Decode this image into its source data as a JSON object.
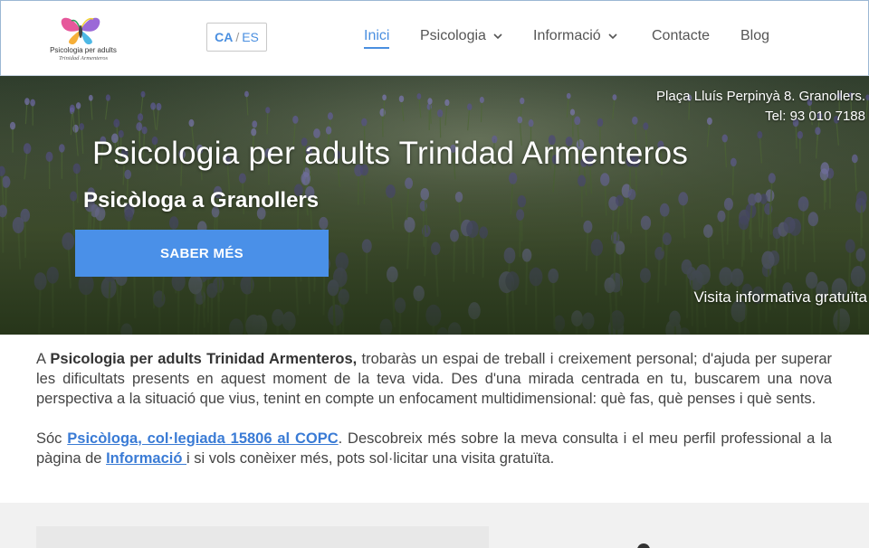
{
  "header": {
    "logo": {
      "line1": "Psicologia per adults",
      "line2": "Trinidad Armenteros"
    },
    "lang": {
      "active": "CA",
      "separator": "/",
      "other": "ES"
    },
    "nav": [
      {
        "label": "Inici",
        "current": true
      },
      {
        "label": "Psicologia",
        "dropdown": true
      },
      {
        "label": "Informació",
        "dropdown": true
      },
      {
        "label": "Contacte"
      },
      {
        "label": "Blog"
      }
    ]
  },
  "hero": {
    "address_line1": "Plaça Lluís Perpinyà 8. Granollers.",
    "address_line2": "Tel: 93 010 7188",
    "title": "Psicologia per adults Trinidad Armenteros",
    "subtitle": "Psicòloga a Granollers",
    "cta_label": "SABER MÉS",
    "visit_text": "Visita informativa gratuïta"
  },
  "content": {
    "p1_bold": "Psicologia per adults Trinidad Armenteros,",
    "p1_prefix": "A ",
    "p1_rest": " trobaràs un espai de treball i creixement personal; d'ajuda per superar les dificultats presents en aquest moment de la teva vida. Des d'una mirada centrada en tu, buscarem una nova perspectiva a la situació que vius, tenint en compte un enfocament multidimensional: què fas, què penses i què sents.",
    "p2_prefix": "Sóc ",
    "p2_link1": "Psicòloga, col·legiada 15806 al COPC",
    "p2_middle": ". Descobreix més sobre la meva consulta i el meu perfil professional a la pàgina de ",
    "p2_link2": "Informació ",
    "p2_suffix": "i si vols conèixer més, pots sol·licitar una visita gratuïta."
  },
  "colors": {
    "accent": "#4a8fe0",
    "cta_bg": "#4a90e8",
    "link": "#3a7bd5"
  }
}
